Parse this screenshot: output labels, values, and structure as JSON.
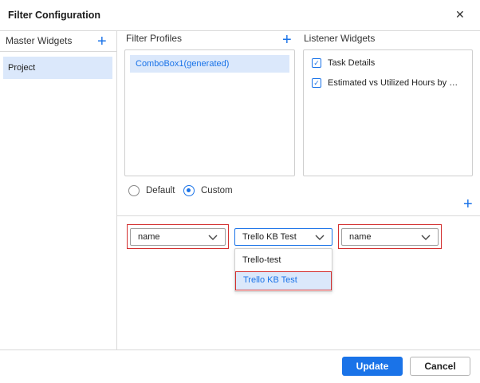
{
  "dialog": {
    "title": "Filter Configuration",
    "close_icon": "close-icon"
  },
  "master_widgets": {
    "heading": "Master Widgets",
    "items": [
      "Project"
    ]
  },
  "filter_profiles": {
    "heading": "Filter Profiles",
    "items": [
      "ComboBox1(generated)"
    ]
  },
  "listener_widgets": {
    "heading": "Listener Widgets",
    "items": [
      {
        "label": "Task Details",
        "checked": true
      },
      {
        "label": "Estimated vs Utilized Hours by Pr...",
        "checked": true
      }
    ]
  },
  "mode": {
    "options": [
      "Default",
      "Custom"
    ],
    "selected": "Custom"
  },
  "filter_row": {
    "master_field": "name",
    "widget_select": "Trello KB Test",
    "listener_field": "name"
  },
  "widget_dropdown": {
    "options": [
      "Trello-test",
      "Trello KB Test"
    ],
    "selected": "Trello KB Test"
  },
  "buttons": {
    "update": "Update",
    "cancel": "Cancel"
  },
  "colors": {
    "accent": "#1a73e8",
    "highlight": "#dbe8fb",
    "outline": "#d32f2f"
  }
}
